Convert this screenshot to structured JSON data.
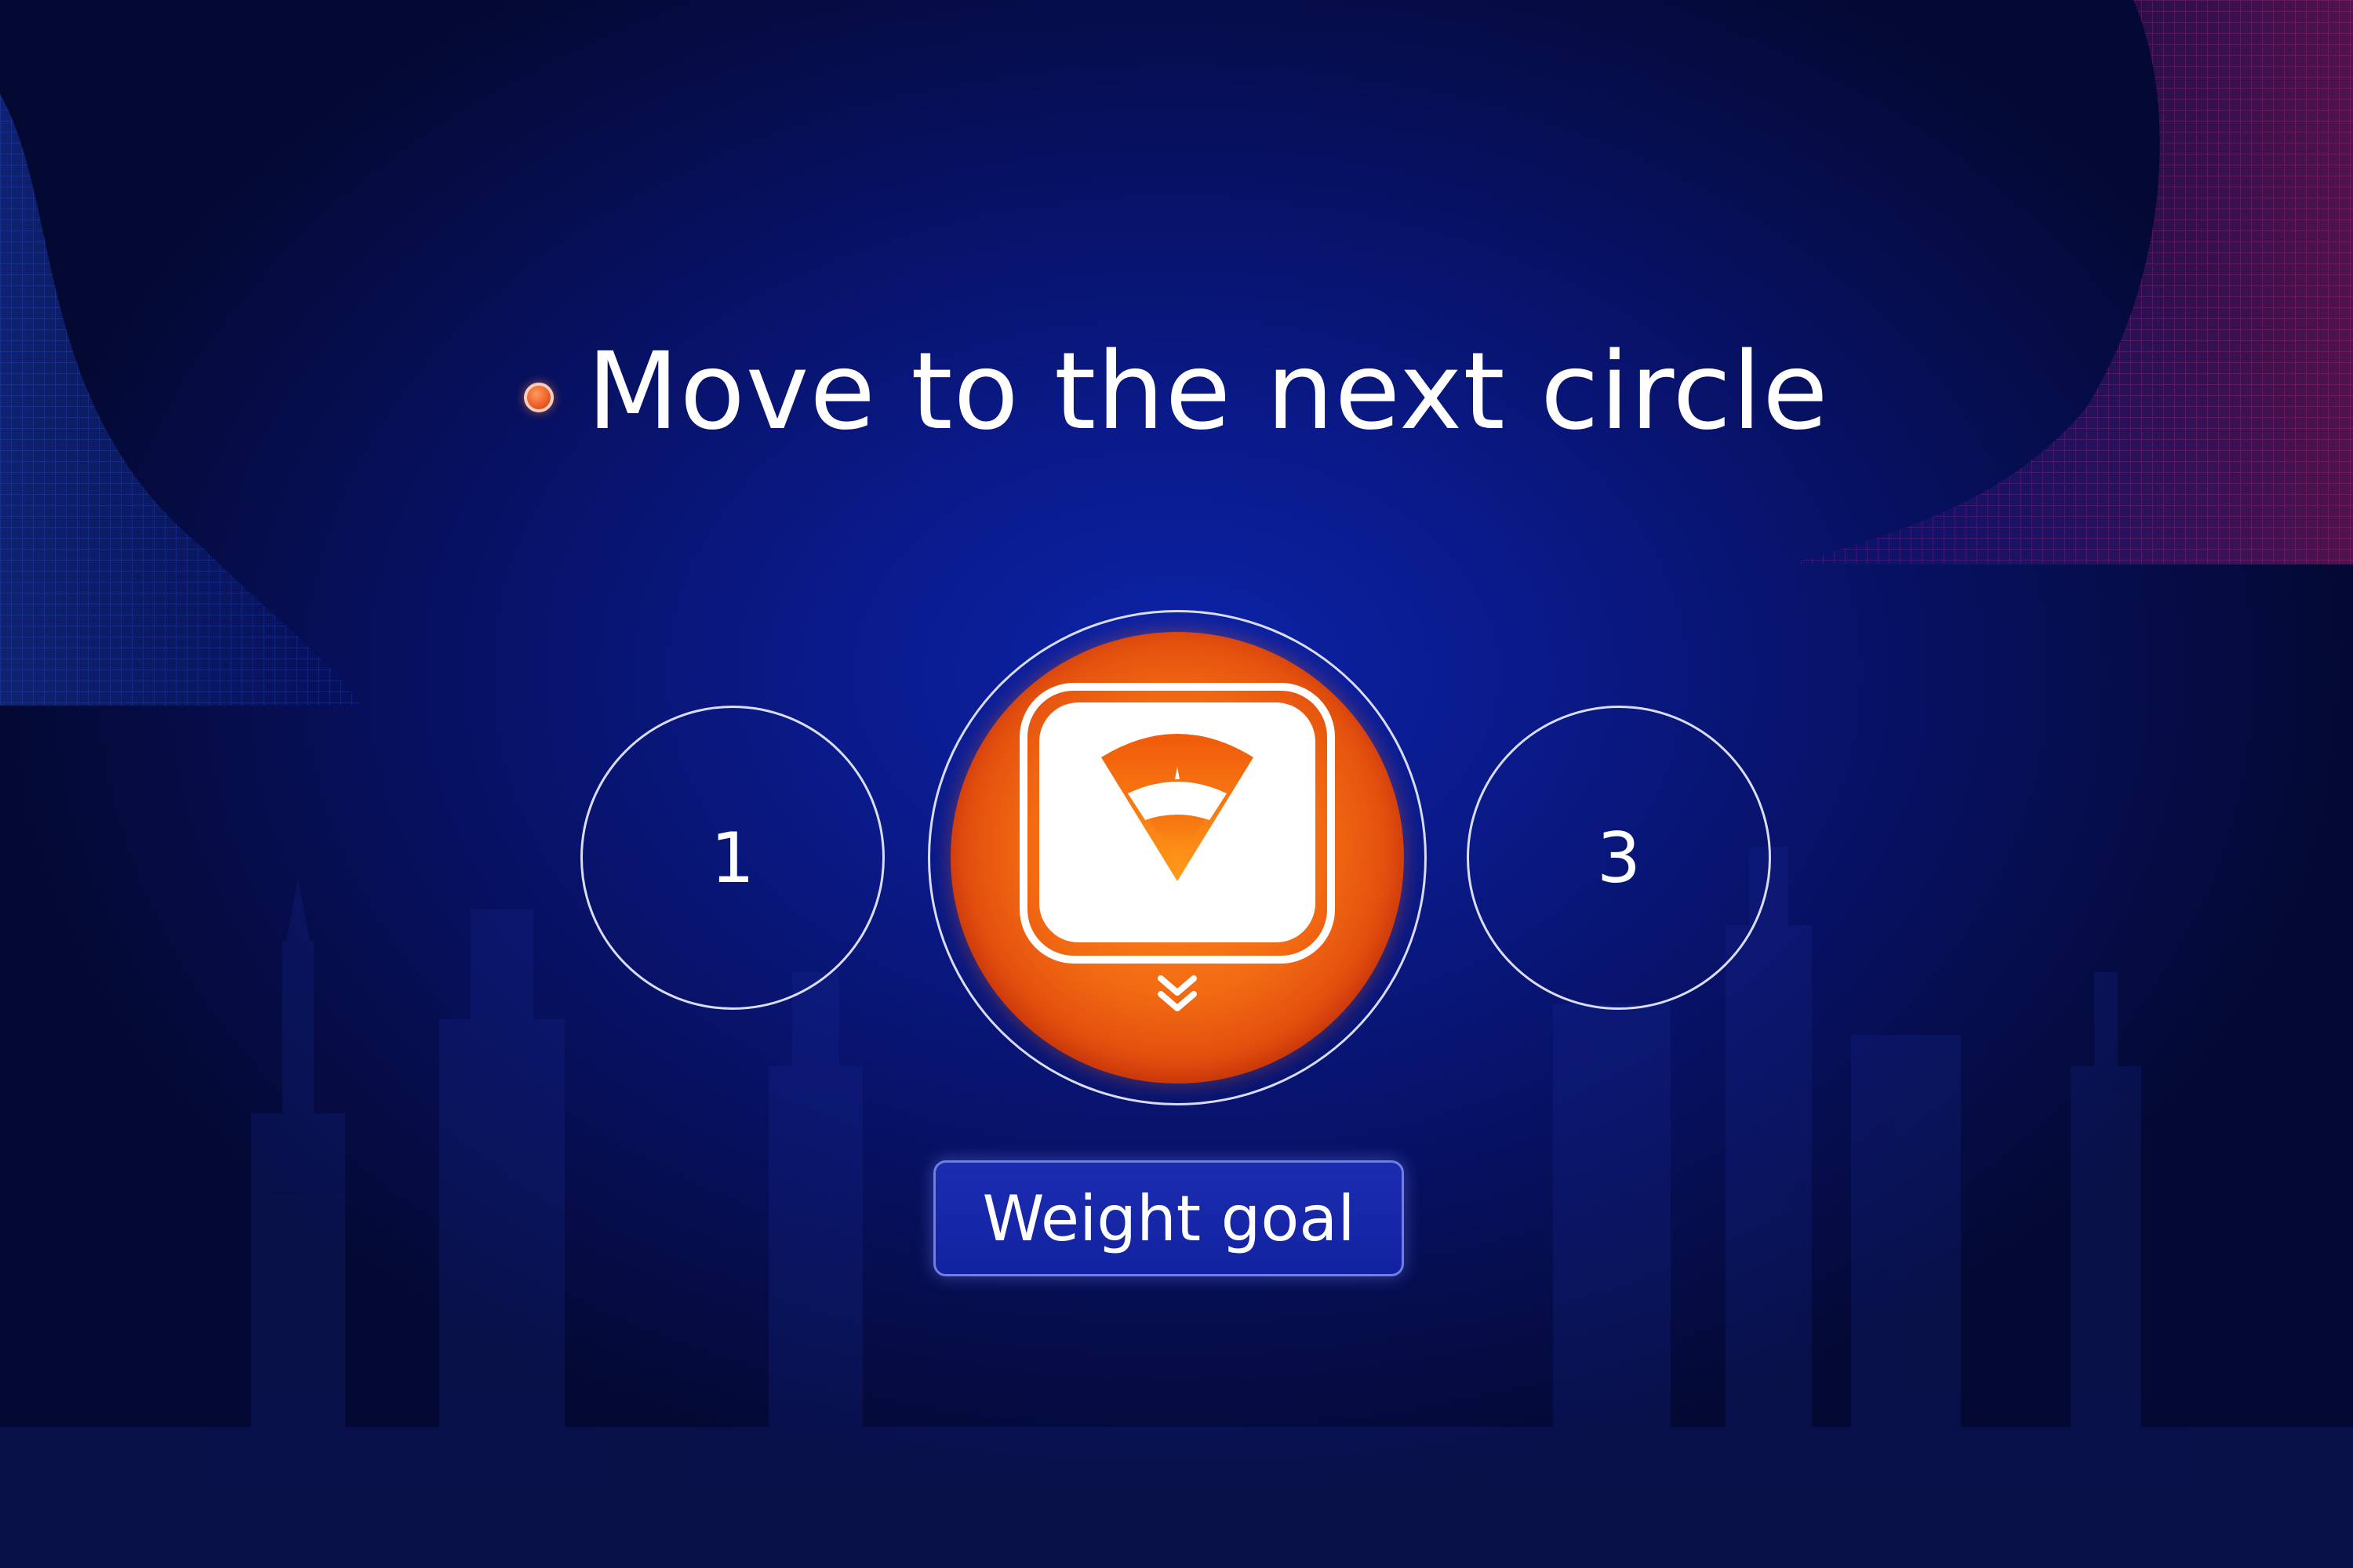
{
  "prompt": {
    "title": "Move to the next circle"
  },
  "steps": [
    {
      "label": "1",
      "state": "inactive"
    },
    {
      "label": "",
      "state": "active",
      "icon": "weight-scale-icon"
    },
    {
      "label": "3",
      "state": "inactive"
    }
  ],
  "active_step": {
    "caption": "Weight goal",
    "icon": "weight-scale-icon",
    "indicator_icon": "chevron-double-down-icon"
  },
  "colors": {
    "background": "#071163",
    "accent": "#f26a12",
    "accent_dark": "#d4350c",
    "ring": "#d9ddf5",
    "label_bg": "#1222a0",
    "text": "#ffffff"
  }
}
